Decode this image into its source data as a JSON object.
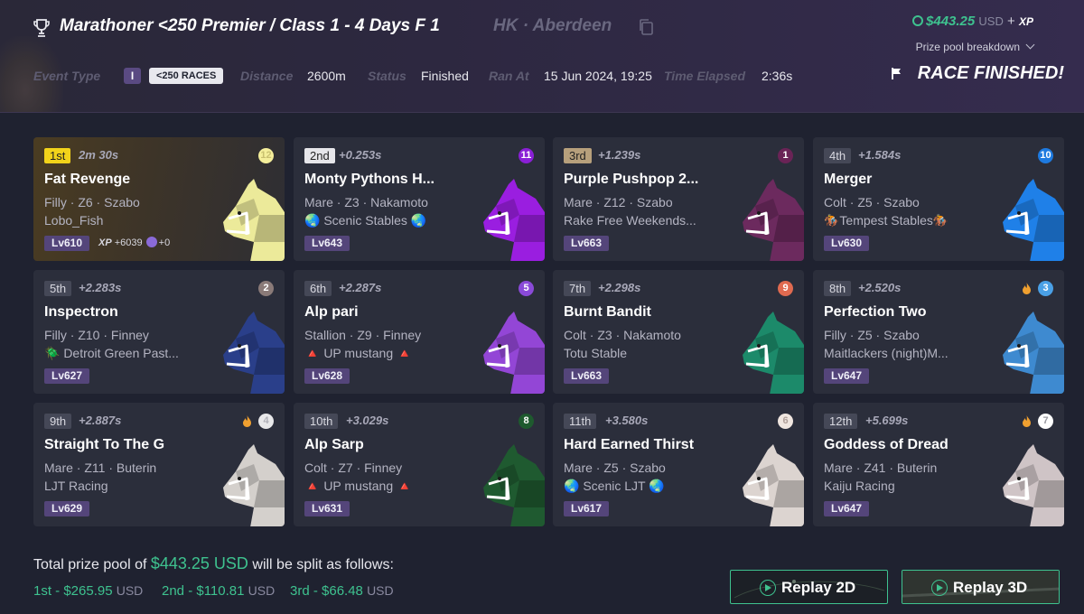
{
  "header": {
    "title": "Marathoner <250 Premier / Class 1 - 4 Days F 1",
    "location": "HK · Aberdeen",
    "event_type_label": "Event Type",
    "class_badge": "I",
    "races_badge": "<250 RACES",
    "distance_label": "Distance",
    "distance_value": "2600m",
    "status_label": "Status",
    "status_value": "Finished",
    "ran_at_label": "Ran At",
    "ran_at_value": "15 Jun 2024, 19:25",
    "time_elapsed_label": "Time Elapsed",
    "time_elapsed_value": "2:36s",
    "prize_amount": "$443.25",
    "prize_currency": "USD",
    "prize_plus": "+",
    "prize_xp": "XP",
    "prize_breakdown_label": "Prize pool breakdown",
    "race_finished": "RACE FINISHED!"
  },
  "results": [
    {
      "place": "1st",
      "gap": "2m 30s",
      "name": "Fat Revenge",
      "info": "Filly · Z6 · Szabo",
      "stable": "Lobo_Fish",
      "level": "Lv610",
      "gate": "12",
      "gate_color": "#f4ee9a",
      "gate_text": "#c9c070",
      "coat": "#ecea9a",
      "xp_label": "XP",
      "xp_value": "+6039",
      "token_value": "+0",
      "flame": false
    },
    {
      "place": "2nd",
      "gap": "+0.253s",
      "name": "Monty Pythons H...",
      "info": "Mare · Z3 · Nakamoto",
      "stable": "🌏 Scenic Stables 🌏",
      "level": "Lv643",
      "gate": "11",
      "gate_color": "#8a1fd6",
      "gate_text": "#ffffff",
      "coat": "#9a1ee0",
      "flame": false
    },
    {
      "place": "3rd",
      "gap": "+1.239s",
      "name": "Purple Pushpop 2...",
      "info": "Mare · Z12 · Szabo",
      "stable": "Rake Free Weekends...",
      "level": "Lv663",
      "gate": "1",
      "gate_color": "#6a2356",
      "gate_text": "#ffffff",
      "coat": "#6c2a5e",
      "flame": false
    },
    {
      "place": "4th",
      "gap": "+1.584s",
      "name": "Merger",
      "info": "Colt · Z5 · Szabo",
      "stable": "🏇Tempest Stables🏇",
      "level": "Lv630",
      "gate": "10",
      "gate_color": "#1e7ae0",
      "gate_text": "#ffffff",
      "coat": "#1f80e8",
      "flame": false
    },
    {
      "place": "5th",
      "gap": "+2.283s",
      "name": "Inspectron",
      "info": "Filly · Z10 · Finney",
      "stable": "🪲 Detroit Green Past...",
      "level": "Lv627",
      "gate": "2",
      "gate_color": "#8a7a78",
      "gate_text": "#ffffff",
      "coat": "#2a3f8a",
      "flame": false
    },
    {
      "place": "6th",
      "gap": "+2.287s",
      "name": "Alp pari",
      "info": "Stallion · Z9 · Finney",
      "stable": "🔺 UP mustang 🔺",
      "level": "Lv628",
      "gate": "5",
      "gate_color": "#8a4ad8",
      "gate_text": "#ffffff",
      "coat": "#9346d6",
      "flame": false
    },
    {
      "place": "7th",
      "gap": "+2.298s",
      "name": "Burnt Bandit",
      "info": "Colt · Z3 · Nakamoto",
      "stable": "Totu Stable",
      "level": "Lv663",
      "gate": "9",
      "gate_color": "#e06a50",
      "gate_text": "#ffffff",
      "coat": "#1c8a6a",
      "flame": false
    },
    {
      "place": "8th",
      "gap": "+2.520s",
      "name": "Perfection Two",
      "info": "Filly · Z5 · Szabo",
      "stable": "Maitlackers (night)M...",
      "level": "Lv647",
      "gate": "3",
      "gate_color": "#4aa0e6",
      "gate_text": "#ffffff",
      "coat": "#3e8ad0",
      "flame": true
    },
    {
      "place": "9th",
      "gap": "+2.887s",
      "name": "Straight To The G",
      "info": "Mare · Z11 · Buterin",
      "stable": "LJT Racing",
      "level": "Lv629",
      "gate": "4",
      "gate_color": "#e8e8ea",
      "gate_text": "#b0b0b8",
      "coat": "#d4d0cc",
      "flame": true
    },
    {
      "place": "10th",
      "gap": "+3.029s",
      "name": "Alp Sarp",
      "info": "Colt · Z7 · Finney",
      "stable": "🔺 UP mustang 🔺",
      "level": "Lv631",
      "gate": "8",
      "gate_color": "#1e5a2e",
      "gate_text": "#ffffff",
      "coat": "#1f5a30",
      "flame": false
    },
    {
      "place": "11th",
      "gap": "+3.580s",
      "name": "Hard Earned Thirst",
      "info": "Mare · Z5 · Szabo",
      "stable": "🌏 Scenic LJT 🌏",
      "level": "Lv617",
      "gate": "6",
      "gate_color": "#f0e6e0",
      "gate_text": "#b0a09a",
      "coat": "#dcd4d0",
      "flame": false
    },
    {
      "place": "12th",
      "gap": "+5.699s",
      "name": "Goddess of Dread",
      "info": "Mare · Z41 · Buterin",
      "stable": "Kaiju Racing",
      "level": "Lv647",
      "gate": "7",
      "gate_color": "#ffffff",
      "gate_text": "#9a9aa2",
      "coat": "#cfc4c6",
      "flame": true
    }
  ],
  "footer": {
    "pool_prefix": "Total prize pool of",
    "pool_amount": "$443.25 USD",
    "pool_suffix": "will be split as follows:",
    "splits": [
      {
        "label": "1st - $265.95",
        "usd": "USD"
      },
      {
        "label": "2nd - $110.81",
        "usd": "USD"
      },
      {
        "label": "3rd - $66.48",
        "usd": "USD"
      }
    ],
    "replay_2d": "Replay 2D",
    "replay_3d": "Replay 3D"
  },
  "colors": {
    "accent_green": "#3ec28f",
    "gold": "#f2d31a",
    "level_purple": "#54457a"
  }
}
